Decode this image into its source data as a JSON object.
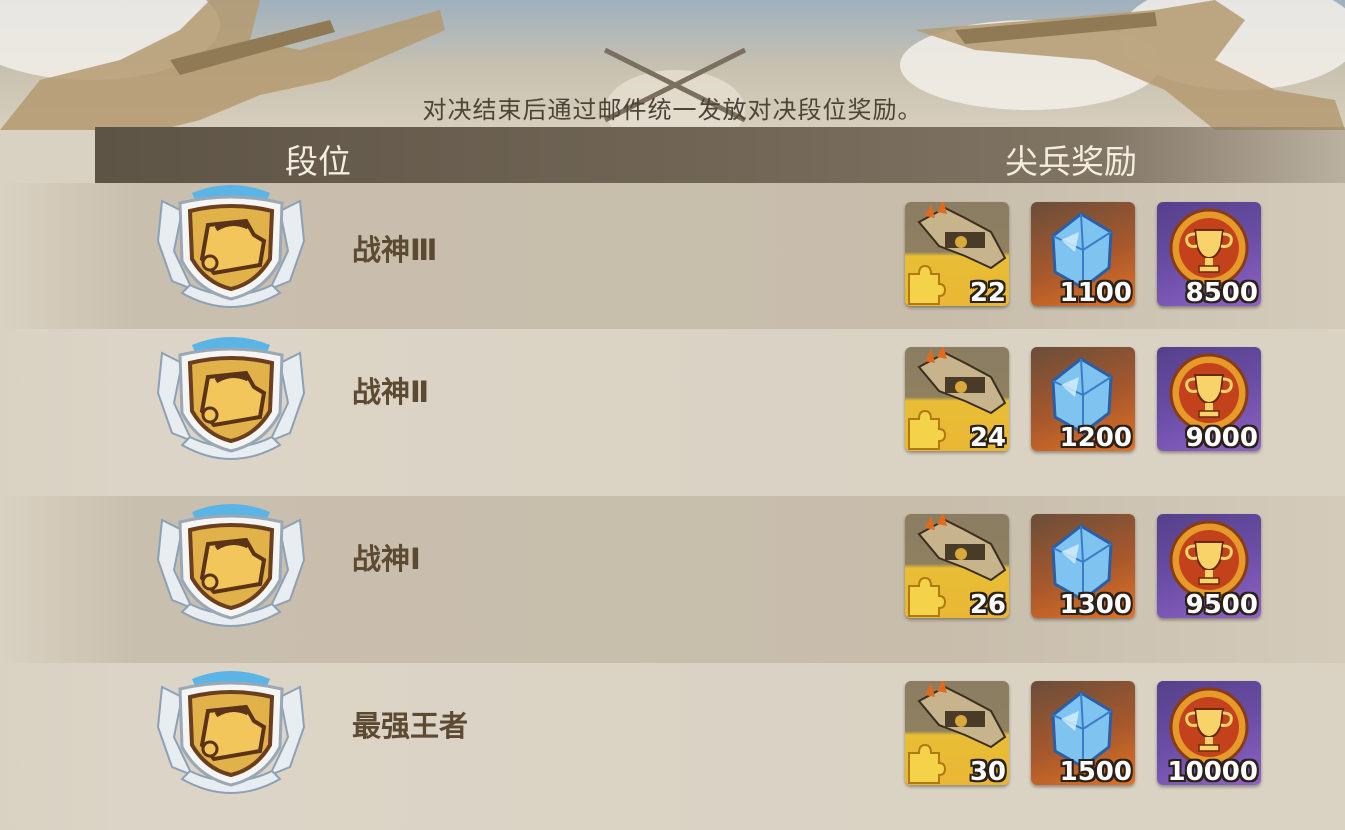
{
  "notice": "对决结束后通过邮件统一发放对决段位奖励。",
  "header": {
    "rank_label": "段位",
    "reward_label": "尖兵奖励"
  },
  "icons": {
    "badge": "tank-rank-badge-icon",
    "reward1": "mech-puzzle-piece-icon",
    "reward2": "blue-crystal-icon",
    "reward3": "trophy-medal-icon"
  },
  "colors": {
    "rank_text": "#5d4a33",
    "header_bg": "#6a5f50",
    "puzzle_bg": "#e8be35",
    "crystal_bg": "#e27323",
    "medal_bg": "#6a4ea6"
  },
  "ranks": [
    {
      "name": "战神Ⅲ",
      "rewards": [
        "22",
        "1100",
        "8500"
      ]
    },
    {
      "name": "战神Ⅱ",
      "rewards": [
        "24",
        "1200",
        "9000"
      ]
    },
    {
      "name": "战神Ⅰ",
      "rewards": [
        "26",
        "1300",
        "9500"
      ]
    },
    {
      "name": "最强王者",
      "rewards": [
        "30",
        "1500",
        "10000"
      ]
    }
  ]
}
